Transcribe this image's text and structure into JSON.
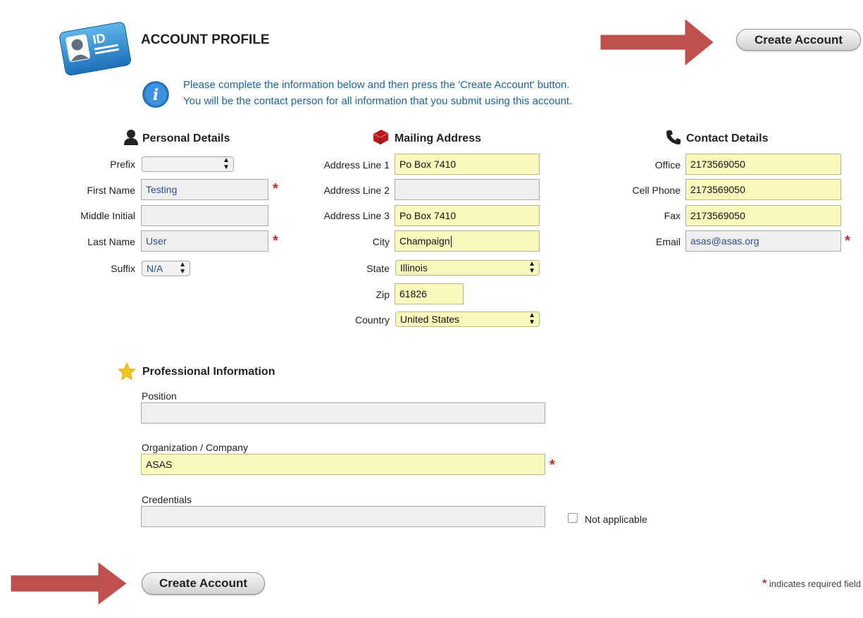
{
  "header": {
    "title": "ACCOUNT PROFILE",
    "logo_text": "ID",
    "create_button_label": "Create Account"
  },
  "info": {
    "line1": "Please complete the information below and then press the 'Create Account' button.",
    "line2": "You will be the contact person for all information that you submit using this account."
  },
  "personal": {
    "title": "Personal Details",
    "prefix_label": "Prefix",
    "prefix_value": "",
    "first_name_label": "First Name",
    "first_name_value": "Testing",
    "middle_initial_label": "Middle Initial",
    "middle_initial_value": "",
    "last_name_label": "Last Name",
    "last_name_value": "User",
    "suffix_label": "Suffix",
    "suffix_value": "N/A"
  },
  "mailing": {
    "title": "Mailing Address",
    "address1_label": "Address Line 1",
    "address1_value": "Po Box 7410",
    "address2_label": "Address Line 2",
    "address2_value": "",
    "address3_label": "Address Line 3",
    "address3_value": "Po Box 7410",
    "city_label": "City",
    "city_value": "Champaign",
    "state_label": "State",
    "state_value": "Illinois",
    "zip_label": "Zip",
    "zip_value": "61826",
    "country_label": "Country",
    "country_value": "United States"
  },
  "contact": {
    "title": "Contact Details",
    "office_label": "Office",
    "office_value": "2173569050",
    "cell_label": "Cell Phone",
    "cell_value": "2173569050",
    "fax_label": "Fax",
    "fax_value": "2173569050",
    "email_label": "Email",
    "email_value": "asas@asas.org"
  },
  "professional": {
    "title": "Professional Information",
    "position_label": "Position",
    "position_value": "",
    "organization_label": "Organization / Company",
    "organization_value": "ASAS",
    "credentials_label": "Credentials",
    "credentials_value": "",
    "not_applicable_label": "Not applicable"
  },
  "footer": {
    "create_button_label": "Create Account",
    "required_star": "*",
    "required_note": " indicates required field"
  },
  "colors": {
    "accent_arrow": "#c0504d",
    "required": "#d2232a",
    "highlight_field": "#fbf8bd",
    "info_text": "#1a64a8"
  }
}
